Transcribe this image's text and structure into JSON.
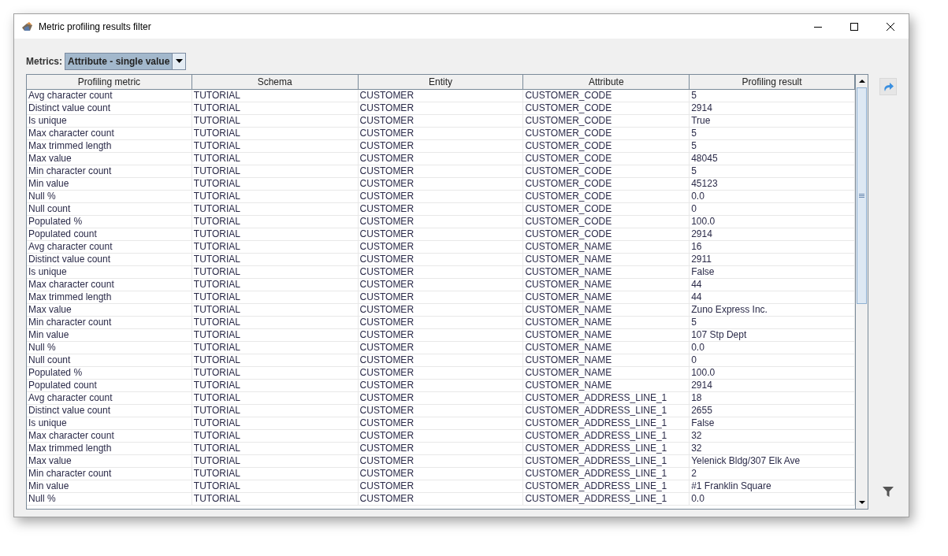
{
  "window": {
    "title": "Metric profiling results filter"
  },
  "metrics": {
    "label": "Metrics:",
    "value": "Attribute - single value"
  },
  "table": {
    "columns": [
      "Profiling metric",
      "Schema",
      "Entity",
      "Attribute",
      "Profiling result"
    ],
    "rows": [
      [
        "Avg character count",
        "TUTORIAL",
        "CUSTOMER",
        "CUSTOMER_CODE",
        "5"
      ],
      [
        "Distinct value count",
        "TUTORIAL",
        "CUSTOMER",
        "CUSTOMER_CODE",
        "2914"
      ],
      [
        "Is unique",
        "TUTORIAL",
        "CUSTOMER",
        "CUSTOMER_CODE",
        "True"
      ],
      [
        "Max character count",
        "TUTORIAL",
        "CUSTOMER",
        "CUSTOMER_CODE",
        "5"
      ],
      [
        "Max trimmed length",
        "TUTORIAL",
        "CUSTOMER",
        "CUSTOMER_CODE",
        "5"
      ],
      [
        "Max value",
        "TUTORIAL",
        "CUSTOMER",
        "CUSTOMER_CODE",
        "48045"
      ],
      [
        "Min character count",
        "TUTORIAL",
        "CUSTOMER",
        "CUSTOMER_CODE",
        "5"
      ],
      [
        "Min value",
        "TUTORIAL",
        "CUSTOMER",
        "CUSTOMER_CODE",
        "45123"
      ],
      [
        "Null %",
        "TUTORIAL",
        "CUSTOMER",
        "CUSTOMER_CODE",
        "0.0"
      ],
      [
        "Null count",
        "TUTORIAL",
        "CUSTOMER",
        "CUSTOMER_CODE",
        "0"
      ],
      [
        "Populated %",
        "TUTORIAL",
        "CUSTOMER",
        "CUSTOMER_CODE",
        "100.0"
      ],
      [
        "Populated count",
        "TUTORIAL",
        "CUSTOMER",
        "CUSTOMER_CODE",
        "2914"
      ],
      [
        "Avg character count",
        "TUTORIAL",
        "CUSTOMER",
        "CUSTOMER_NAME",
        "16"
      ],
      [
        "Distinct value count",
        "TUTORIAL",
        "CUSTOMER",
        "CUSTOMER_NAME",
        "2911"
      ],
      [
        "Is unique",
        "TUTORIAL",
        "CUSTOMER",
        "CUSTOMER_NAME",
        "False"
      ],
      [
        "Max character count",
        "TUTORIAL",
        "CUSTOMER",
        "CUSTOMER_NAME",
        "44"
      ],
      [
        "Max trimmed length",
        "TUTORIAL",
        "CUSTOMER",
        "CUSTOMER_NAME",
        "44"
      ],
      [
        "Max value",
        "TUTORIAL",
        "CUSTOMER",
        "CUSTOMER_NAME",
        "Zuno Express Inc."
      ],
      [
        "Min character count",
        "TUTORIAL",
        "CUSTOMER",
        "CUSTOMER_NAME",
        "5"
      ],
      [
        "Min value",
        "TUTORIAL",
        "CUSTOMER",
        "CUSTOMER_NAME",
        "107 Stp Dept"
      ],
      [
        "Null %",
        "TUTORIAL",
        "CUSTOMER",
        "CUSTOMER_NAME",
        "0.0"
      ],
      [
        "Null count",
        "TUTORIAL",
        "CUSTOMER",
        "CUSTOMER_NAME",
        "0"
      ],
      [
        "Populated %",
        "TUTORIAL",
        "CUSTOMER",
        "CUSTOMER_NAME",
        "100.0"
      ],
      [
        "Populated count",
        "TUTORIAL",
        "CUSTOMER",
        "CUSTOMER_NAME",
        "2914"
      ],
      [
        "Avg character count",
        "TUTORIAL",
        "CUSTOMER",
        "CUSTOMER_ADDRESS_LINE_1",
        "18"
      ],
      [
        "Distinct value count",
        "TUTORIAL",
        "CUSTOMER",
        "CUSTOMER_ADDRESS_LINE_1",
        "2655"
      ],
      [
        "Is unique",
        "TUTORIAL",
        "CUSTOMER",
        "CUSTOMER_ADDRESS_LINE_1",
        "False"
      ],
      [
        "Max character count",
        "TUTORIAL",
        "CUSTOMER",
        "CUSTOMER_ADDRESS_LINE_1",
        "32"
      ],
      [
        "Max trimmed length",
        "TUTORIAL",
        "CUSTOMER",
        "CUSTOMER_ADDRESS_LINE_1",
        "32"
      ],
      [
        "Max value",
        "TUTORIAL",
        "CUSTOMER",
        "CUSTOMER_ADDRESS_LINE_1",
        "Yelenick Bldg/307 Elk Ave"
      ],
      [
        "Min character count",
        "TUTORIAL",
        "CUSTOMER",
        "CUSTOMER_ADDRESS_LINE_1",
        "2"
      ],
      [
        "Min value",
        "TUTORIAL",
        "CUSTOMER",
        "CUSTOMER_ADDRESS_LINE_1",
        "#1 Franklin Square"
      ],
      [
        "Null %",
        "TUTORIAL",
        "CUSTOMER",
        "CUSTOMER_ADDRESS_LINE_1",
        "0.0"
      ]
    ]
  }
}
